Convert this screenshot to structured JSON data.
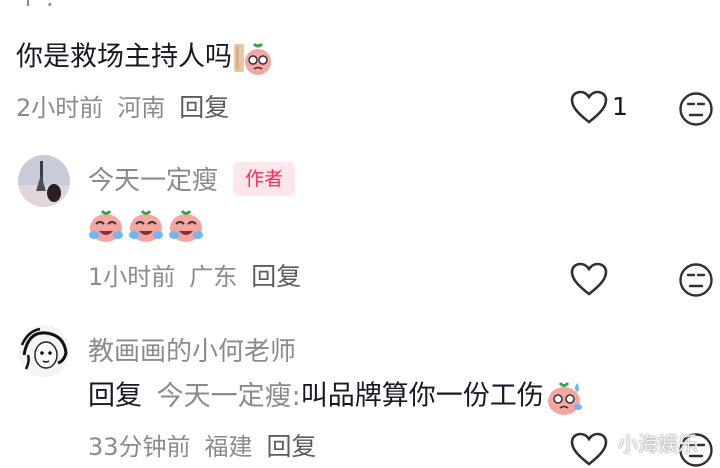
{
  "top_fragment": "↑ :",
  "comments": [
    {
      "text": "你是救场主持人吗",
      "time": "2小时前",
      "location": "河南",
      "reply_label": "回复",
      "like_count": "1"
    },
    {
      "username": "今天一定瘦",
      "author_badge": "作者",
      "time": "1小时前",
      "location": "广东",
      "reply_label": "回复"
    },
    {
      "username": "教画画的小何老师",
      "reply_label_inline": "回复",
      "reply_to": "今天一定瘦:",
      "text": "叫品牌算你一份工伤",
      "time": "33分钟前",
      "location": "福建",
      "reply_label": "回复"
    }
  ],
  "watermark": "小海娱乐",
  "colors": {
    "accent": "#fe2c55",
    "badge_bg": "#fde7ea",
    "muted": "#8a8b91"
  }
}
